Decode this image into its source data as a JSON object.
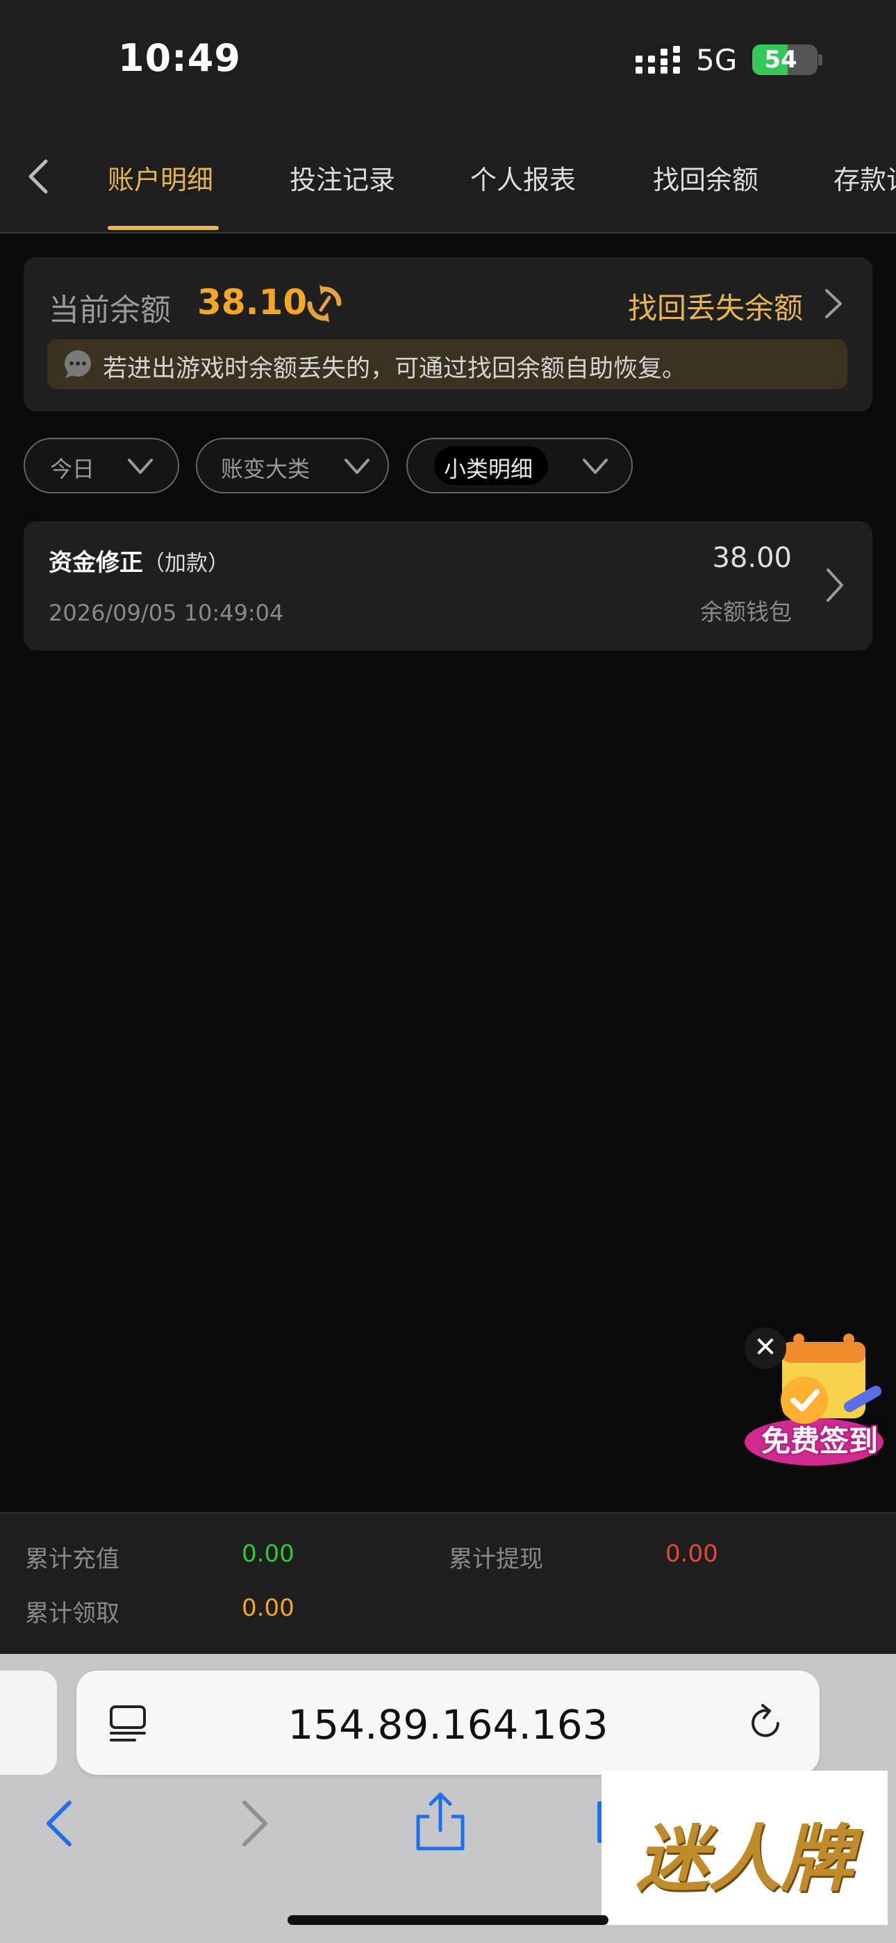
{
  "status_bar": {
    "time": "10:49",
    "network": "5G",
    "battery": "54",
    "battery_level": 0.54
  },
  "tabs": [
    {
      "label": "账户明细",
      "active": true
    },
    {
      "label": "投注记录",
      "active": false
    },
    {
      "label": "个人报表",
      "active": false
    },
    {
      "label": "找回余额",
      "active": false
    },
    {
      "label": "存款记录",
      "active": false
    }
  ],
  "balance": {
    "label": "当前余额",
    "value": "38.10",
    "recover_link": "找回丢失余额",
    "notice": "若进出游戏时余额丢失的，可通过找回余额自助恢复。"
  },
  "filters": {
    "date": "今日",
    "major_category": "账变大类",
    "minor_category": "小类明细"
  },
  "records": [
    {
      "title": "资金修正",
      "type": "（加款）",
      "time": "2026/09/05 10:49:04",
      "amount": "38.00",
      "wallet": "余额钱包"
    }
  ],
  "floating_badge": {
    "label": "免费签到",
    "close": "✕"
  },
  "totals": {
    "recharge_label": "累计充值",
    "recharge_value": "0.00",
    "withdraw_label": "累计提现",
    "withdraw_value": "0.00",
    "claim_label": "累计领取",
    "claim_value": "0.00"
  },
  "browser": {
    "url": "154.89.164.163"
  },
  "watermark": "迷人牌",
  "colors": {
    "accent": "#e6b450",
    "balance": "#f5a623",
    "green": "#2ecc2e",
    "red": "#e5483b",
    "orange": "#f5a623"
  }
}
